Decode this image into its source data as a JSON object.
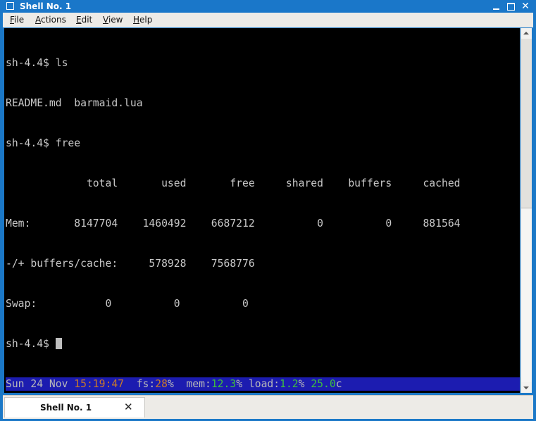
{
  "window": {
    "title": "Shell No. 1",
    "icon": "window-icon",
    "controls": [
      "minimize",
      "maximize",
      "close"
    ]
  },
  "menu": {
    "items": [
      {
        "label": "File",
        "mnemonic": "F"
      },
      {
        "label": "Actions",
        "mnemonic": "A"
      },
      {
        "label": "Edit",
        "mnemonic": "E"
      },
      {
        "label": "View",
        "mnemonic": "V"
      },
      {
        "label": "Help",
        "mnemonic": "H"
      }
    ]
  },
  "terminal": {
    "lines": [
      "sh-4.4$ ls",
      "README.md  barmaid.lua",
      "sh-4.4$ free",
      "             total       used       free     shared    buffers     cached",
      "Mem:       8147704    1460492    6687212          0          0     881564",
      "-/+ buffers/cache:     578928    7568776",
      "Swap:           0          0          0"
    ],
    "prompt": "sh-4.4$ "
  },
  "status": {
    "date": "Sun 24 Nov ",
    "time": "15:19:47",
    "fs_label": "  fs:",
    "fs_value": "28",
    "fs_unit": "%",
    "mem_label": "  mem:",
    "mem_value": "12.3",
    "mem_unit": "%",
    "load_label": " load:",
    "load_value": "1.2",
    "load_unit": "% ",
    "temp_value": "25.0",
    "temp_unit": "c"
  },
  "tabs": [
    {
      "label": "Shell No. 1",
      "active": true
    }
  ],
  "colors": {
    "titlebar": "#1a77c9",
    "statusbar": "#1c1cb0",
    "time": "#c9792a",
    "value": "#3ec03e"
  }
}
